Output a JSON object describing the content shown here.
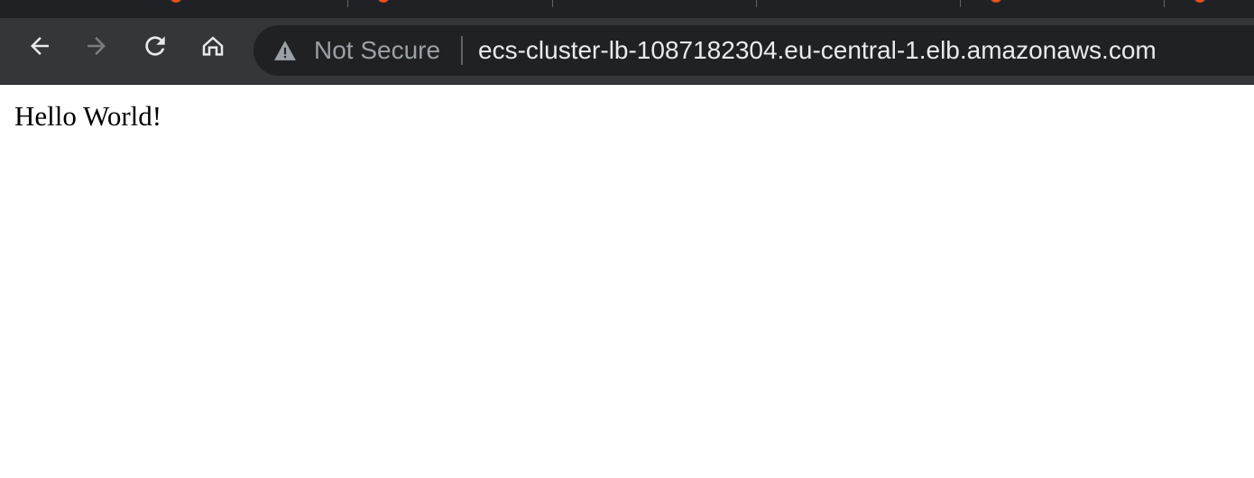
{
  "browser": {
    "tabs": [
      {
        "label": "",
        "has_favicon": true
      },
      {
        "label": "",
        "has_favicon": true
      },
      {
        "label": "",
        "has_favicon": false
      },
      {
        "label": "",
        "has_favicon": false
      },
      {
        "label": "",
        "has_favicon": true
      },
      {
        "label": "",
        "has_favicon": true
      }
    ],
    "toolbar": {
      "back_icon": "arrow-left-icon",
      "forward_icon": "arrow-right-icon",
      "reload_icon": "reload-icon",
      "home_icon": "home-icon",
      "forward_enabled": false
    },
    "address_bar": {
      "security_icon": "warning-triangle-icon",
      "security_label": "Not Secure",
      "url": "ecs-cluster-lb-1087182304.eu-central-1.elb.amazonaws.com"
    },
    "colors": {
      "tabstrip_bg": "#202124",
      "toolbar_bg": "#35363a",
      "omnibox_bg": "#202124",
      "url_text": "#e8eaed",
      "security_text": "#9aa0a6"
    }
  },
  "page": {
    "body_text": "Hello World!"
  }
}
